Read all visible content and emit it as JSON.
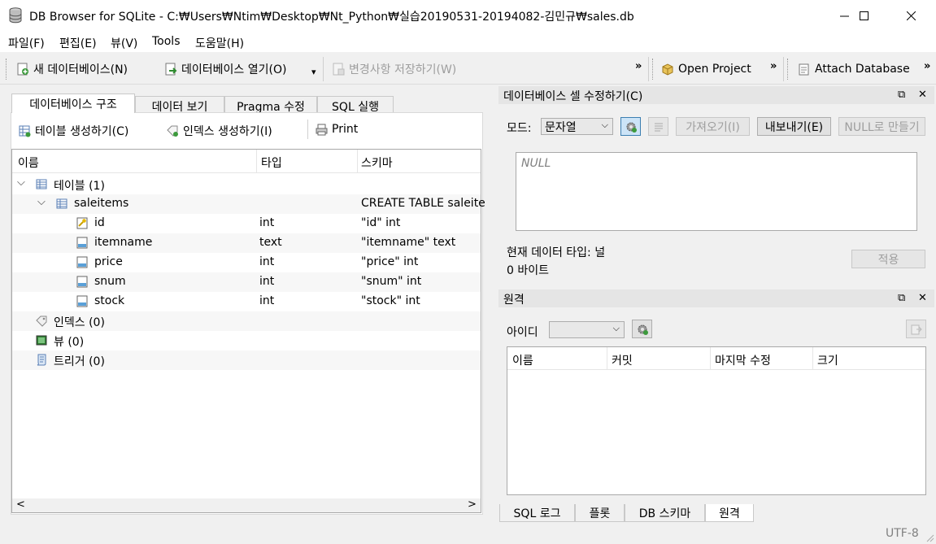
{
  "window": {
    "title": "DB Browser for SQLite - C:₩Users₩Ntim₩Desktop₩Nt_Python₩실습20190531-20194082-김민규₩sales.db",
    "minimize": "—",
    "maximize": "☐",
    "close": "✕"
  },
  "menu": [
    "파일(F)",
    "편집(E)",
    "뷰(V)",
    "Tools",
    "도움말(H)"
  ],
  "toolbar": {
    "new_db": "새 데이터베이스(N)",
    "open_db": "데이터베이스 열기(O)",
    "open_db_arrow": "▾",
    "write_changes": "변경사항 저장하기(W)",
    "more1": "»",
    "open_project": "Open Project",
    "more2": "»",
    "attach_db": "Attach Database",
    "more3": "»"
  },
  "left_tabs": [
    "데이터베이스 구조",
    "데이터 보기",
    "Pragma 수정",
    "SQL 실행"
  ],
  "structure_toolbar": {
    "create_table": "테이블 생성하기(C)",
    "create_index": "인덱스 생성하기(I)",
    "print": "Print"
  },
  "tree": {
    "headers": [
      "이름",
      "타입",
      "스키마"
    ],
    "rows": [
      {
        "name": "테이블 (1)",
        "type": "",
        "schema": ""
      },
      {
        "name": "saleitems",
        "type": "",
        "schema": "CREATE TABLE saleite"
      },
      {
        "name": "id",
        "type": "int",
        "schema": "\"id\" int"
      },
      {
        "name": "itemname",
        "type": "text",
        "schema": "\"itemname\" text"
      },
      {
        "name": "price",
        "type": "int",
        "schema": "\"price\" int"
      },
      {
        "name": "snum",
        "type": "int",
        "schema": "\"snum\" int"
      },
      {
        "name": "stock",
        "type": "int",
        "schema": "\"stock\" int"
      },
      {
        "name": "인덱스 (0)",
        "type": "",
        "schema": ""
      },
      {
        "name": "뷰 (0)",
        "type": "",
        "schema": ""
      },
      {
        "name": "트리거 (0)",
        "type": "",
        "schema": ""
      }
    ],
    "scroll_left": "<",
    "scroll_right": ">"
  },
  "cell_editor": {
    "title": "데이터베이스 셀 수정하기(C)",
    "mode_label": "모드:",
    "mode_value": "문자열",
    "import_btn": "가져오기(I)",
    "export_btn": "내보내기(E)",
    "null_btn": "NULL로 만들기",
    "content": "NULL",
    "type_label": "현재 데이터 타입: 널",
    "size_label": "0 바이트",
    "apply_btn": "적용"
  },
  "remote": {
    "title": "원격",
    "id_label": "아이디",
    "id_value": "",
    "headers": [
      "이름",
      "커밋",
      "마지막 수정",
      "크기"
    ]
  },
  "bottom_tabs": [
    "SQL 로그",
    "플롯",
    "DB 스키마",
    "원격"
  ],
  "status": {
    "encoding": "UTF-8"
  },
  "colors": {
    "title_bg": "#ffffff",
    "dock_title_bg": "#e5e5e5",
    "disabled_text": "#9e9e9e",
    "null_text": "#808080"
  }
}
